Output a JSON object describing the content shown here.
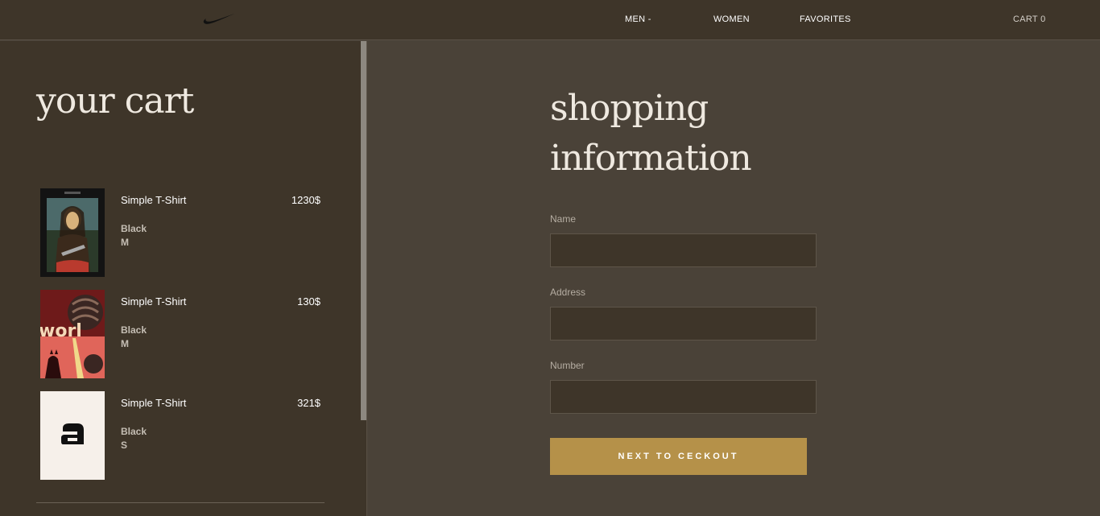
{
  "header": {
    "logo_icon": "swoosh-icon",
    "nav": {
      "men": "MEN -",
      "women": "WOMEN",
      "favorites": "FAVORITES",
      "cart": "CART 0"
    }
  },
  "cart": {
    "title": "your cart",
    "items": [
      {
        "name": "Simple T-Shirt",
        "price": "1230$",
        "color": "Black",
        "size": "M",
        "image": "mona-lisa-print"
      },
      {
        "name": "Simple T-Shirt",
        "price": "130$",
        "color": "Black",
        "size": "M",
        "image": "world-poster-print"
      },
      {
        "name": "Simple T-Shirt",
        "price": "321$",
        "color": "Black",
        "size": "S",
        "image": "letter-a-print"
      }
    ]
  },
  "form": {
    "title_line1": "shopping",
    "title_line2": "information",
    "fields": {
      "name_label": "Name",
      "address_label": "Address",
      "number_label": "Number"
    },
    "submit_label": "NEXT TO CECKOUT"
  },
  "colors": {
    "header_bg": "#3e3529",
    "page_bg": "#4a4238",
    "accent": "#b59149"
  }
}
